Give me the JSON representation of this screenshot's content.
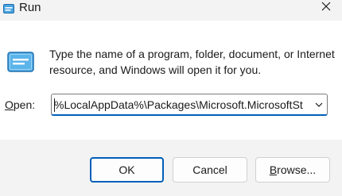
{
  "window": {
    "title": "Run",
    "icon": "run-icon",
    "close_icon": "close-icon"
  },
  "content": {
    "description": "Type the name of a program, folder, document, or Internet resource, and Windows will open it for you.",
    "open_label_accel": "O",
    "open_label_rest": "pen:",
    "open_value": "%LocalAppData%\\Packages\\Microsoft.MicrosoftSt"
  },
  "buttons": {
    "ok": "OK",
    "cancel": "Cancel",
    "browse_accel": "B",
    "browse_rest": "rowse..."
  },
  "colors": {
    "accent": "#005fb8",
    "window_bg": "#f3f3f3",
    "content_bg": "#ffffff"
  }
}
